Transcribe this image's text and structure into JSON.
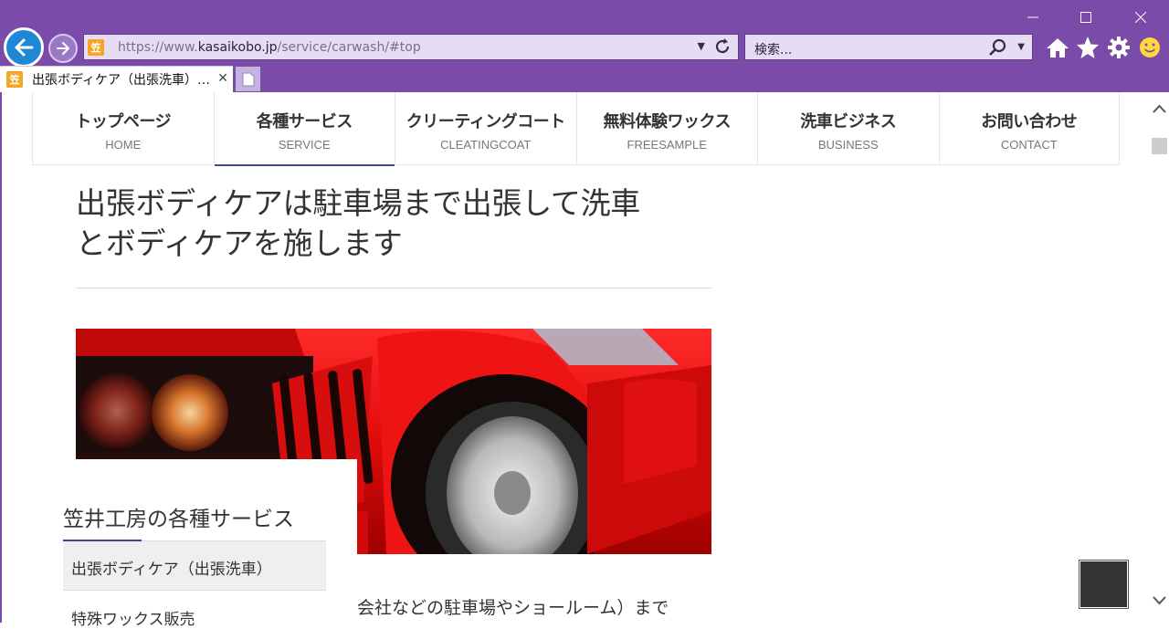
{
  "browser": {
    "url_prefix": "https://www.",
    "url_domain": "kasaikobo.jp",
    "url_path": "/service/carwash/#top",
    "search_placeholder": "検索...",
    "tab_title": "出張ボディケア（出張洗車）…",
    "accent_color": "#7a4ba8"
  },
  "nav": {
    "items": [
      {
        "jp": "トップページ",
        "en": "HOME"
      },
      {
        "jp": "各種サービス",
        "en": "SERVICE"
      },
      {
        "jp": "クリーティングコート",
        "en": "CLEATINGCOAT"
      },
      {
        "jp": "無料体験ワックス",
        "en": "FREESAMPLE"
      },
      {
        "jp": "洗車ビジネス",
        "en": "BUSINESS"
      },
      {
        "jp": "お問い合わせ",
        "en": "CONTACT"
      }
    ],
    "active_index": 1
  },
  "page": {
    "title_line1": "出張ボディケアは駐車場まで出張して洗車",
    "title_line2": "とボディケアを施します",
    "body_text": "会社などの駐車場やショールーム）まで"
  },
  "sidebar": {
    "heading": "笠井工房の各種サービス",
    "items": [
      "出張ボディケア（出張洗車）",
      "特殊ワックス販売"
    ]
  }
}
